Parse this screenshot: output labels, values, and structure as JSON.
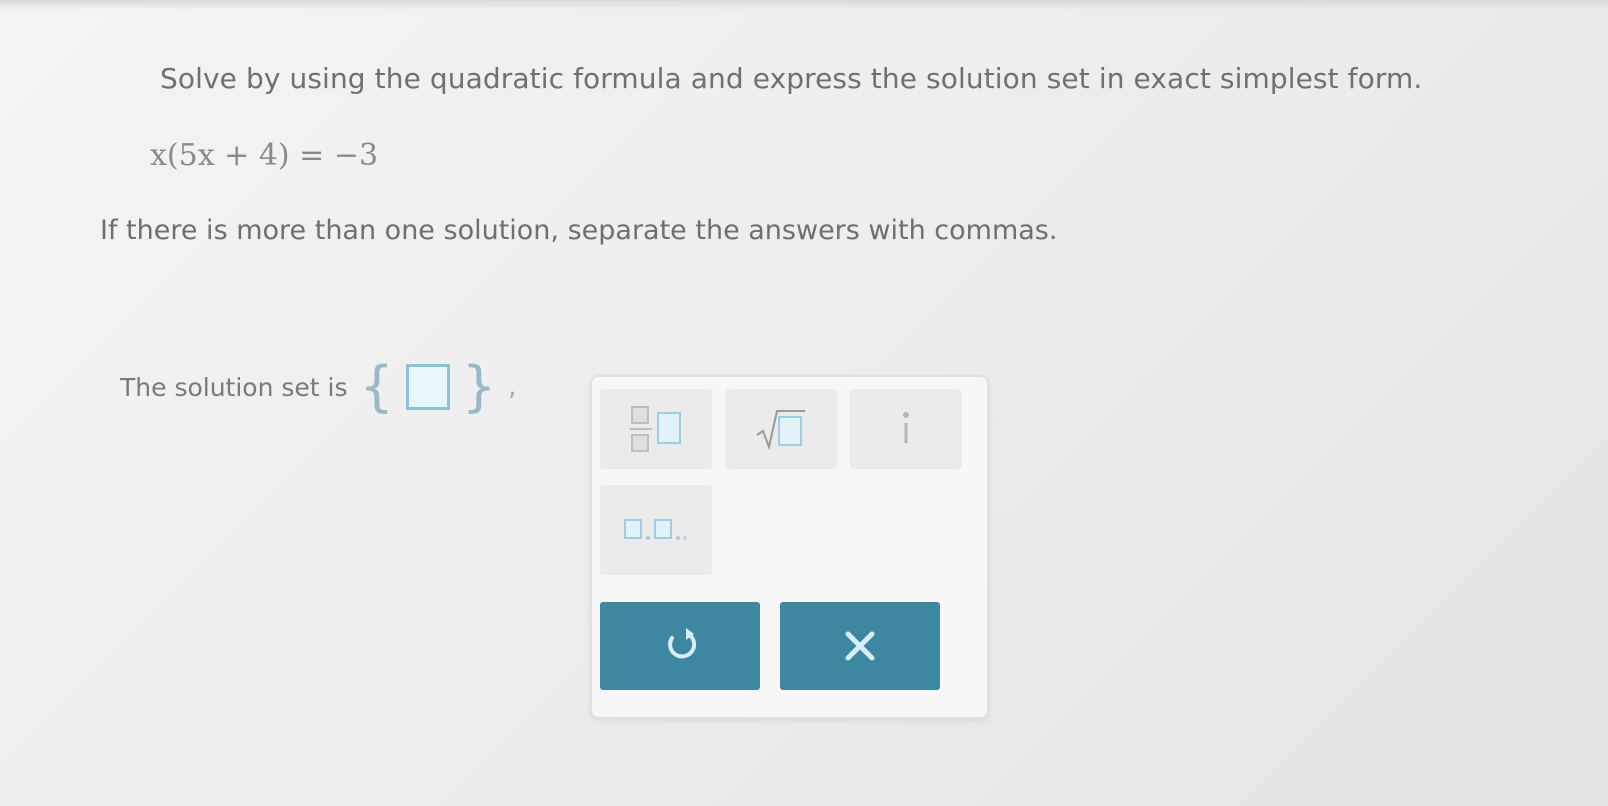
{
  "problem": {
    "instruction": "Solve by using the quadratic formula and express the solution set in exact simplest form.",
    "equation": "x(5x + 4) = −3",
    "hint": "If there is more than one solution, separate the answers with commas."
  },
  "answer": {
    "label": "The solution set is",
    "open_brace": "{",
    "close_brace": "}",
    "comma": ","
  },
  "keypad": {
    "keys": [
      {
        "icon": "fraction-icon"
      },
      {
        "icon": "sqrt-icon",
        "symbol": "√"
      },
      {
        "icon": "imaginary-unit-icon",
        "symbol": "i"
      },
      {
        "icon": "comma-list-icon",
        "symbol": ","
      }
    ],
    "undo_icon": "undo-icon",
    "clear_icon": "clear-icon"
  },
  "colors": {
    "accent": "#3d87a0",
    "input_border": "#8fc2d6"
  }
}
